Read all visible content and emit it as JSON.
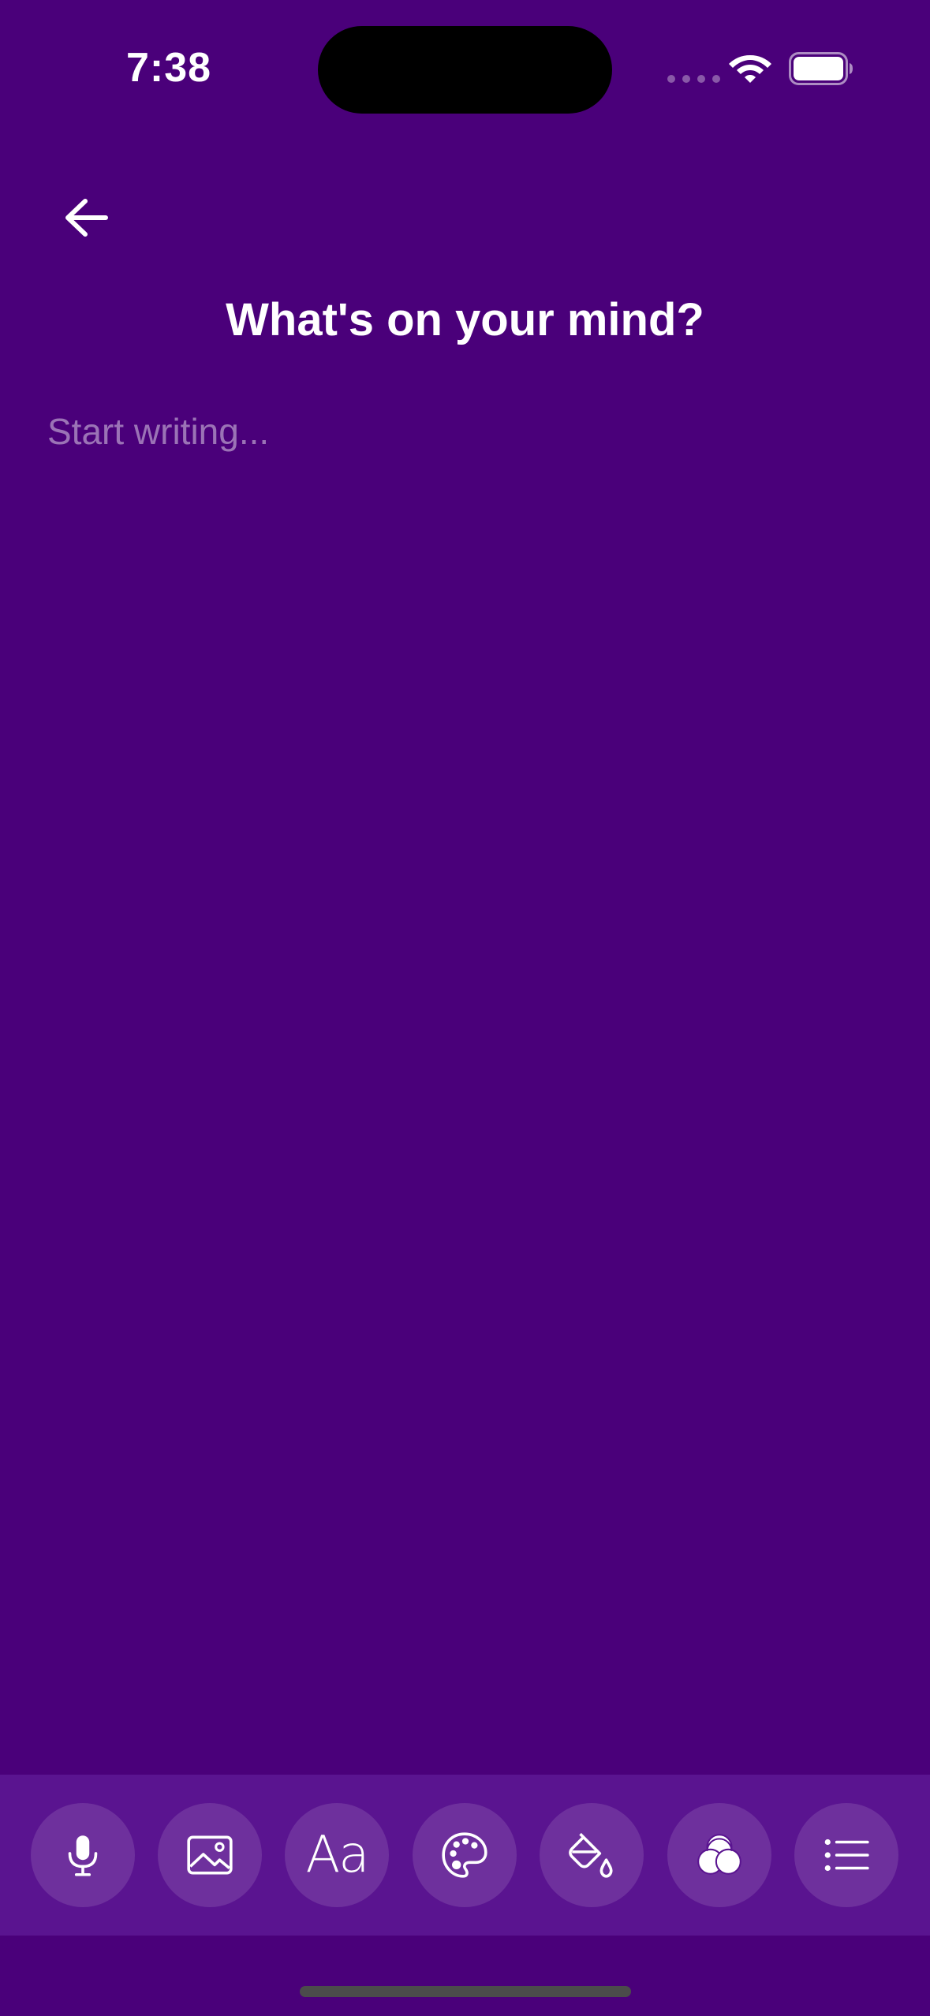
{
  "status_bar": {
    "time": "7:38"
  },
  "header": {
    "back_icon": "arrow-left-icon",
    "title": "What's on your mind?"
  },
  "editor": {
    "placeholder": "Start writing...",
    "value": ""
  },
  "toolbar": {
    "items": [
      {
        "name": "microphone",
        "icon": "microphone-icon"
      },
      {
        "name": "image",
        "icon": "image-icon"
      },
      {
        "name": "font",
        "icon": "font-icon",
        "label": "Aa"
      },
      {
        "name": "palette",
        "icon": "palette-icon"
      },
      {
        "name": "fill",
        "icon": "paint-bucket-icon"
      },
      {
        "name": "color-mix",
        "icon": "color-filter-icon"
      },
      {
        "name": "list",
        "icon": "list-icon"
      }
    ]
  },
  "colors": {
    "background": "#4a007a",
    "toolbar": "#5a1490",
    "text": "#ffffff"
  }
}
